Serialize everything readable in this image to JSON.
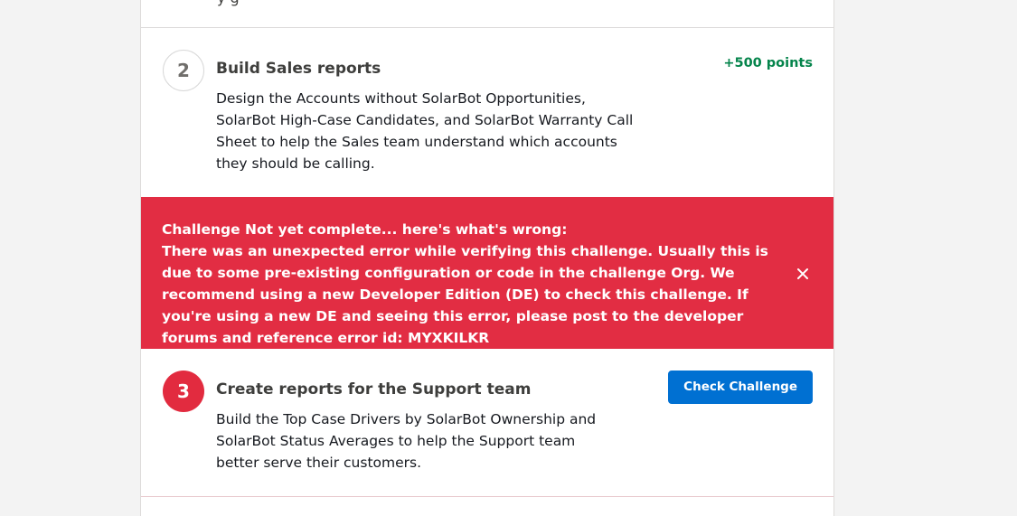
{
  "steps": {
    "step2": {
      "number": "2",
      "title": "Build Sales reports",
      "points": "+500 points",
      "description": "Design the Accounts without SolarBot Opportunities, SolarBot High-Case Candidates, and SolarBot Warranty Call Sheet to help the Sales team understand which accounts they should be calling."
    },
    "step3": {
      "number": "3",
      "title": "Create reports for the Support team",
      "button_label": "Check Challenge",
      "description": "Build the Top Case Drivers by SolarBot Ownership and SolarBot Status Averages to help the Support team better serve their customers."
    }
  },
  "error": {
    "heading": "Challenge Not yet complete... here's what's wrong:",
    "message": "There was an unexpected error while verifying this challenge. Usually this is due to some pre-existing configuration or code in the challenge Org. We recommend using a new Developer Edition (DE) to check this challenge. If you're using a new DE and seeing this error, please post to the developer forums and reference error id: MYXKILKR"
  },
  "icons": {
    "close": "close-icon"
  },
  "colors": {
    "error_bg": "#e22d43",
    "brand_blue": "#0070d2",
    "points_green": "#04844b",
    "badge_red": "#e22b3f"
  }
}
